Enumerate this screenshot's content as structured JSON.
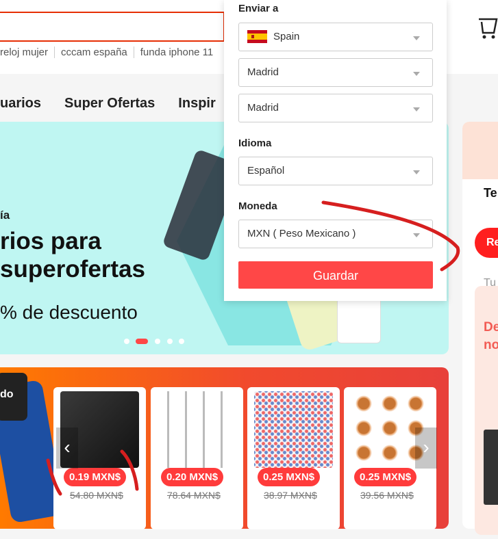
{
  "search": {
    "suggestions": [
      "reloj mujer",
      "cccam españa",
      "funda iphone 11"
    ]
  },
  "nav": {
    "items": [
      "uarios",
      "Super Ofertas",
      "Inspir"
    ]
  },
  "banner": {
    "small": "ía",
    "line1": "rios para",
    "line2": "superofertas",
    "line3": "% de descuento",
    "active_dot": 1
  },
  "deals": {
    "watch_label": "do",
    "cards": [
      {
        "price": "0.19 MXN$",
        "old_price": "54.80 MXN$",
        "image": "phone-case"
      },
      {
        "price": "0.20 MXN$",
        "old_price": "78.64 MXN$",
        "image": "drill-bits"
      },
      {
        "price": "0.25 MXN$",
        "old_price": "38.97 MXN$",
        "image": "rhinestones"
      },
      {
        "price": "0.25 MXN$",
        "old_price": "39.56 MXN$",
        "image": "copper-wire"
      }
    ]
  },
  "right": {
    "te": "Te",
    "button": "Re",
    "tu": "Tu",
    "de_line1": "De",
    "de_line2": "no"
  },
  "popup": {
    "ship_to_label": "Enviar a",
    "country": "Spain",
    "region": "Madrid",
    "city": "Madrid",
    "language_label": "Idioma",
    "language": "Español",
    "currency_label": "Moneda",
    "currency": "MXN ( Peso Mexicano )",
    "save": "Guardar"
  },
  "colors": {
    "accent": "#ff4747",
    "search_border": "#e62e04",
    "banner_bg": "#bff6f2",
    "deals_gradient_start": "#ff7a00",
    "deals_gradient_end": "#e8403a",
    "annotation": "#d61f1f"
  },
  "icons": [
    "cart-icon",
    "spain-flag-icon",
    "chevron-down-icon",
    "chevron-left-icon",
    "chevron-right-icon"
  ]
}
